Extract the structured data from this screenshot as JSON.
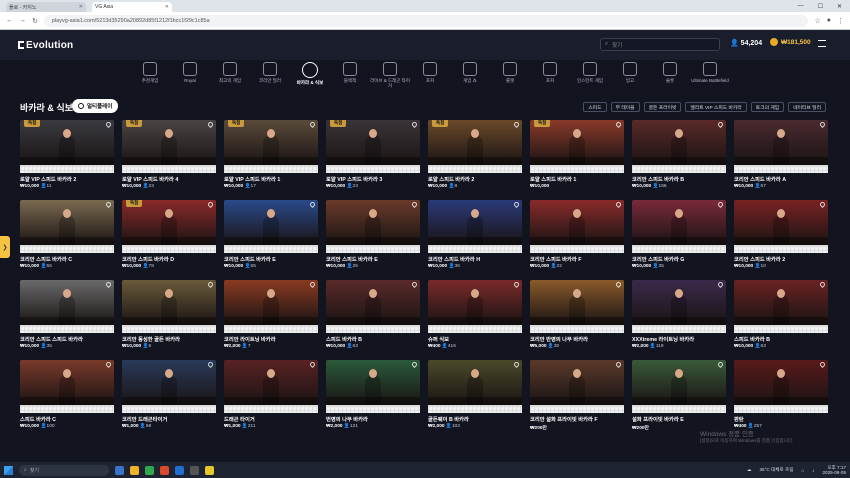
{
  "browser": {
    "tabs": [
      {
        "label": "플로 - 카지노"
      },
      {
        "label": "VG Asia"
      }
    ],
    "url": "playvg-asia1.com/5213d35290a20892d85f1212f1bcc1f29c1c85a"
  },
  "header": {
    "logo": "Evolution",
    "search_placeholder": "찾기",
    "account": "54,204",
    "balance": "₩181,500"
  },
  "categories": [
    {
      "label": "추천게임"
    },
    {
      "label": "Royal"
    },
    {
      "label": "최고의 게임"
    },
    {
      "label": "코리안 딜러"
    },
    {
      "label": "바카라 & 식보"
    },
    {
      "label": "블랙잭"
    },
    {
      "label": "라이브 & 드래곤 타이거"
    },
    {
      "label": "포커"
    },
    {
      "label": "게임 쇼"
    },
    {
      "label": "룰렛"
    },
    {
      "label": "포커"
    },
    {
      "label": "인스턴트 게임"
    },
    {
      "label": "빙고"
    },
    {
      "label": "슬롯"
    },
    {
      "label": "Ultimate Battlefield"
    }
  ],
  "section": {
    "title": "바카라 & 식보",
    "multi_button": "멀티플레이",
    "filters": [
      "스피드",
      "무 테이블",
      "골든 프라이빗",
      "엘리트 VIP 스피드 바카라",
      "토크의 게임",
      "네이티브 딜러"
    ]
  },
  "games": [
    {
      "name": "로얄 VIP 스피드 바카라 2",
      "min": "₩10,000",
      "players": "11",
      "badge": "독점",
      "thumb": "#3a3a40"
    },
    {
      "name": "로얄 VIP 스피드 바카라 4",
      "min": "₩10,000",
      "players": "23",
      "badge": "독점",
      "thumb": "#4a4444"
    },
    {
      "name": "로얄 VIP 스피드 바카라 1",
      "min": "₩10,000",
      "players": "17",
      "badge": "독점",
      "thumb": "#5a4a3a"
    },
    {
      "name": "로얄 VIP 스피드 바카라 3",
      "min": "₩10,000",
      "players": "23",
      "badge": "독점",
      "thumb": "#3a3438"
    },
    {
      "name": "로얄 스피드 바카라 2",
      "min": "₩10,000",
      "players": "8",
      "badge": "독점",
      "thumb": "#6a4a2a"
    },
    {
      "name": "로얄 스피드 바카라 1",
      "min": "₩10,000",
      "players": "",
      "badge": "독점",
      "thumb": "#8a3a2a"
    },
    {
      "name": "코리안 스피드 바카라 B",
      "min": "₩10,000",
      "players": "166",
      "badge": "",
      "thumb": "#5a2a28"
    },
    {
      "name": "코리안 스피드 바카라 A",
      "min": "₩10,000",
      "players": "67",
      "badge": "",
      "thumb": "#4a2a30"
    },
    {
      "name": "코리안 스피드 바카라 C",
      "min": "₩10,000",
      "players": "55",
      "badge": "",
      "thumb": "#7a6a50"
    },
    {
      "name": "코리안 스피드 바카라 D",
      "min": "₩10,000",
      "players": "78",
      "badge": "독점",
      "thumb": "#8a2a28"
    },
    {
      "name": "코리안 스피드 바카라 E",
      "min": "₩10,000",
      "players": "65",
      "badge": "",
      "thumb": "#2a4a8a"
    },
    {
      "name": "코리안 스피드 바카라 E",
      "min": "₩10,000",
      "players": "25",
      "badge": "",
      "thumb": "#6a3a2a"
    },
    {
      "name": "코리안 스피드 바카라 H",
      "min": "₩10,000",
      "players": "36",
      "badge": "",
      "thumb": "#2a3a7a"
    },
    {
      "name": "코리안 스피드 바카라 F",
      "min": "₩10,000",
      "players": "22",
      "badge": "",
      "thumb": "#8a2a2a"
    },
    {
      "name": "코리안 스피드 바카라 G",
      "min": "₩10,000",
      "players": "35",
      "badge": "",
      "thumb": "#7a2a3a"
    },
    {
      "name": "코리안 스피드 바카라 2",
      "min": "₩10,000",
      "players": "10",
      "badge": "",
      "thumb": "#7a2222"
    },
    {
      "name": "코리안 스피드 스피드 바카라",
      "min": "₩10,000",
      "players": "35",
      "badge": "",
      "thumb": "#6a6a6a"
    },
    {
      "name": "코리안 동성한 골든 바카라",
      "min": "₩10,000",
      "players": "6",
      "badge": "",
      "thumb": "#6a5a3a"
    },
    {
      "name": "코리안 라이트닝 바카라",
      "min": "₩2,000",
      "players": "7",
      "badge": "",
      "thumb": "#8a3a22"
    },
    {
      "name": "스피드 바카라 B",
      "min": "₩10,000",
      "players": "63",
      "badge": "",
      "thumb": "#5a2a2a"
    },
    {
      "name": "슈퍼 식보",
      "min": "₩400",
      "players": "416",
      "badge": "",
      "thumb": "#7a2a2a"
    },
    {
      "name": "코리안 반영의 나무 바카라",
      "min": "₩5,000",
      "players": "30",
      "badge": "",
      "thumb": "#8a5a2a"
    },
    {
      "name": "XXXtreme 라이트닝 바카라",
      "min": "₩2,000",
      "players": "119",
      "badge": "",
      "thumb": "#3a2a4a"
    },
    {
      "name": "스피드 바카라 B",
      "min": "₩10,000",
      "players": "63",
      "badge": "",
      "thumb": "#6a2222"
    },
    {
      "name": "스피드 바카라 C",
      "min": "₩10,000",
      "players": "100",
      "badge": "",
      "thumb": "#7a3a2a"
    },
    {
      "name": "코리안 드래곤타이거",
      "min": "₩1,000",
      "players": "58",
      "badge": "",
      "thumb": "#2a3a5a"
    },
    {
      "name": "드래곤 타이거",
      "min": "₩1,000",
      "players": "211",
      "badge": "",
      "thumb": "#5a2222"
    },
    {
      "name": "번영의 나무 바카라",
      "min": "₩2,000",
      "players": "121",
      "badge": "",
      "thumb": "#2a5a3a"
    },
    {
      "name": "골든웨이 B 바카라",
      "min": "₩2,000",
      "players": "103",
      "badge": "",
      "thumb": "#4a4a2a"
    },
    {
      "name": "코리안 설화 프라이빗 바카라 F",
      "min": "₩200만",
      "players": "",
      "badge": "",
      "thumb": "#5a3a2a"
    },
    {
      "name": "설화 프라이빗 바카라 E",
      "min": "₩200만",
      "players": "",
      "badge": "",
      "thumb": "#3a5a3a"
    },
    {
      "name": "판탄",
      "min": "₩400",
      "players": "257",
      "badge": "",
      "thumb": "#5a1a1a"
    }
  ],
  "taskbar": {
    "search": "찾기",
    "weather": "35°C 대체로 흐림",
    "time": "오후 7:17",
    "date": "2025-08-05"
  },
  "watermark": {
    "line1": "Windows 정품 인증",
    "line2": "[설정]으로 이동하여 Windows를 정품 인증합니다."
  }
}
